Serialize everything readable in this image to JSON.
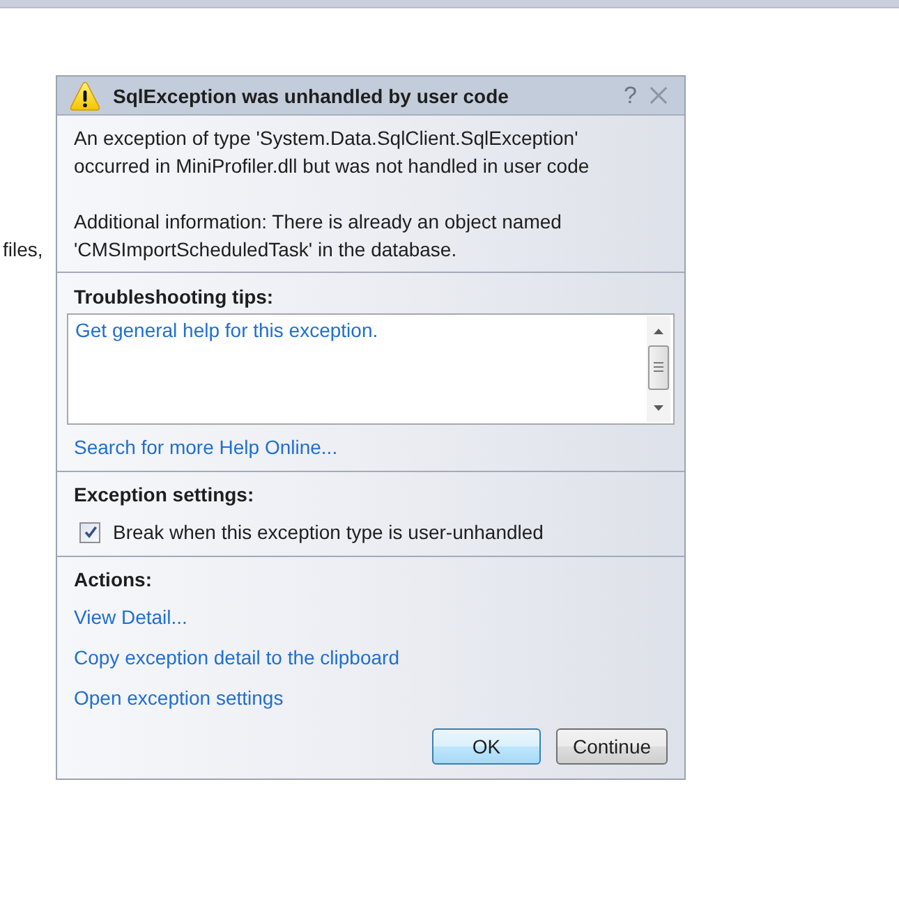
{
  "background_text": "files,",
  "dialog": {
    "title": "SqlException was unhandled by user code",
    "help": "?",
    "message": "An exception of type 'System.Data.SqlClient.SqlException'\noccurred in MiniProfiler.dll but was not handled in user code",
    "additional_information": "Additional information: There is already an object named\n'CMSImportScheduledTask' in the database.",
    "troubleshooting": {
      "heading": "Troubleshooting tips:",
      "tips": [
        "Get general help for this exception."
      ],
      "help_link": "Search for more Help Online..."
    },
    "exception_settings": {
      "heading": "Exception settings:",
      "options": [
        {
          "label": "Break when this exception type is user-unhandled",
          "checked": true
        }
      ]
    },
    "actions": {
      "heading": "Actions:",
      "links": [
        "View Detail...",
        "Copy exception detail to the clipboard",
        "Open exception settings"
      ]
    },
    "buttons": [
      {
        "label": "OK",
        "default": true
      },
      {
        "label": "Continue",
        "default": false
      }
    ]
  }
}
